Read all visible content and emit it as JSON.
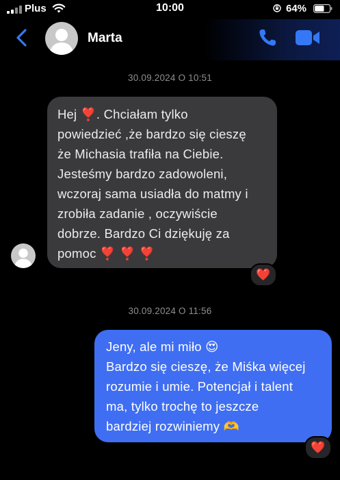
{
  "status_bar": {
    "carrier": "Plus",
    "time": "10:00",
    "battery_percent": "64%",
    "battery_level": 0.64,
    "icons": [
      "signal-icon",
      "wifi-icon",
      "orientation-lock-icon",
      "battery-icon"
    ]
  },
  "header": {
    "contact_name": "Marta",
    "icons": [
      "back-chevron-icon",
      "phone-icon",
      "video-camera-icon"
    ],
    "accent_color": "#3478f6"
  },
  "messages": [
    {
      "timestamp": "30.09.2024 O 10:51",
      "direction": "incoming",
      "lines": [
        "Hej  ❣️. Chciałam tylko",
        "powiedzieć ,że bardzo się cieszę",
        "że Michasia trafiła na Ciebie.",
        "Jesteśmy bardzo zadowoleni,",
        "wczoraj sama usiadła do matmy i",
        "zrobiła zadanie , oczywiście",
        "dobrze. Bardzo Ci dziękuję za",
        "pomoc  ❣️ ❣️ ❣️"
      ],
      "reaction": "❤️"
    },
    {
      "timestamp": "30.09.2024 O 11:56",
      "direction": "outgoing",
      "lines": [
        "Jeny, ale mi miło 😍",
        "Bardzo się cieszę, że Miśka więcej",
        "rozumie i umie. Potencjał i talent",
        "ma, tylko trochę to jeszcze",
        "bardziej rozwiniemy 🫶"
      ],
      "reaction": "❤️"
    }
  ],
  "colors": {
    "incoming_bubble": "#3a3a3c",
    "outgoing_bubble": "#3f6ef2",
    "timestamp": "#8e8e93"
  }
}
